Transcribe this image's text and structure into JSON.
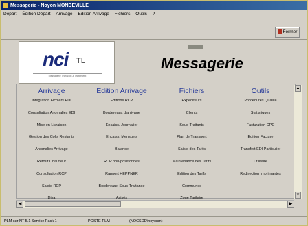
{
  "window": {
    "title": "Messagerie - Noyon MONDEVILLE"
  },
  "menu": [
    "Départ",
    "Édition Départ",
    "Arrivage",
    "Edition Arrivage",
    "Fichiers",
    "Outils",
    "?"
  ],
  "toolbar": {
    "fermer_label": "Fermer"
  },
  "logo": {
    "main": "nci",
    "suffix": "TL",
    "tagline": "Messagerie Transport & Traitement"
  },
  "app_title": "Messagerie",
  "columns": [
    {
      "header": "Arrivage",
      "items": [
        "Intégration Fichiers EDI",
        "Consultation Anomalies EDI",
        "Mise en Livraison",
        "Gestion des Colis Restants",
        "Anomalies Arrivage",
        "Retour Chauffeur",
        "Consultation RCP",
        "Saisie RCP",
        "Diva"
      ]
    },
    {
      "header": "Edition Arrivage",
      "items": [
        "Editions RCP",
        "Bordereaux d'arrivage",
        "Encaiss. Journalier",
        "Encaiss. Mensuels",
        "Balance",
        "RCP non-positionnés",
        "Rapport HEPPNER",
        "Bordereaux Sous-Traitance",
        "Avisés"
      ]
    },
    {
      "header": "Fichiers",
      "items": [
        "Expéditeurs",
        "Clients",
        "Sous-Traitants",
        "Plan de Transport",
        "Saisie des Tarifs",
        "Maintenance des Tarifs",
        "Edition des Tarifs",
        "Communes",
        "Zone Tarifaire"
      ]
    },
    {
      "header": "Outils",
      "items": [
        "Procédures Qualité",
        "Statistiques",
        "Facturation CPC",
        "Edition Facture",
        "Transfert EDI Particulier",
        "Utilitaire",
        "Redirection Imprimantes"
      ]
    }
  ],
  "status": {
    "os": "PLM sur NT 5.1 Service Pack 1",
    "host": "POSTE-PLM",
    "user": "(NOCSDD\\noyonm)"
  }
}
